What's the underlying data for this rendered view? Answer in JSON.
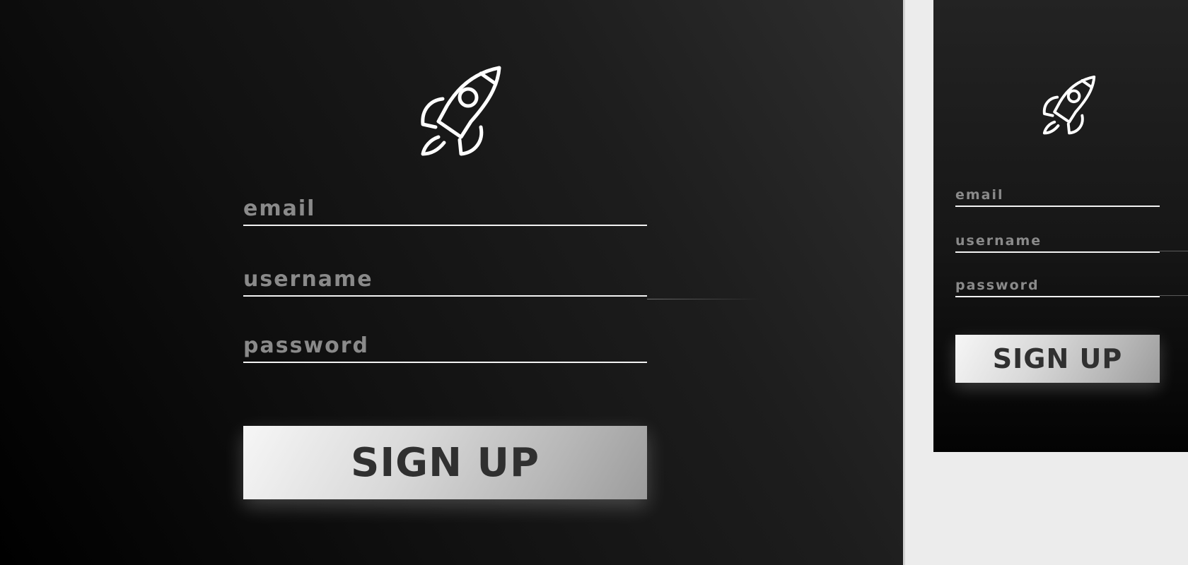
{
  "large_form": {
    "email_placeholder": "email",
    "username_placeholder": "username",
    "password_placeholder": "password",
    "signup_label": "SIGN UP"
  },
  "small_form": {
    "email_placeholder": "email",
    "username_placeholder": "username",
    "password_placeholder": "password",
    "signup_label": "SIGN UP"
  },
  "icons": {
    "logo": "rocket-icon"
  },
  "colors": {
    "panel_dark": "#000000",
    "panel_mid": "#1d1d1d",
    "placeholder_text": "#8a8a8a",
    "underline": "#f2f2f2",
    "button_light": "#f6f6f6",
    "button_dark": "#9c9c9c",
    "button_text": "#303030",
    "page_background": "#ececec"
  }
}
